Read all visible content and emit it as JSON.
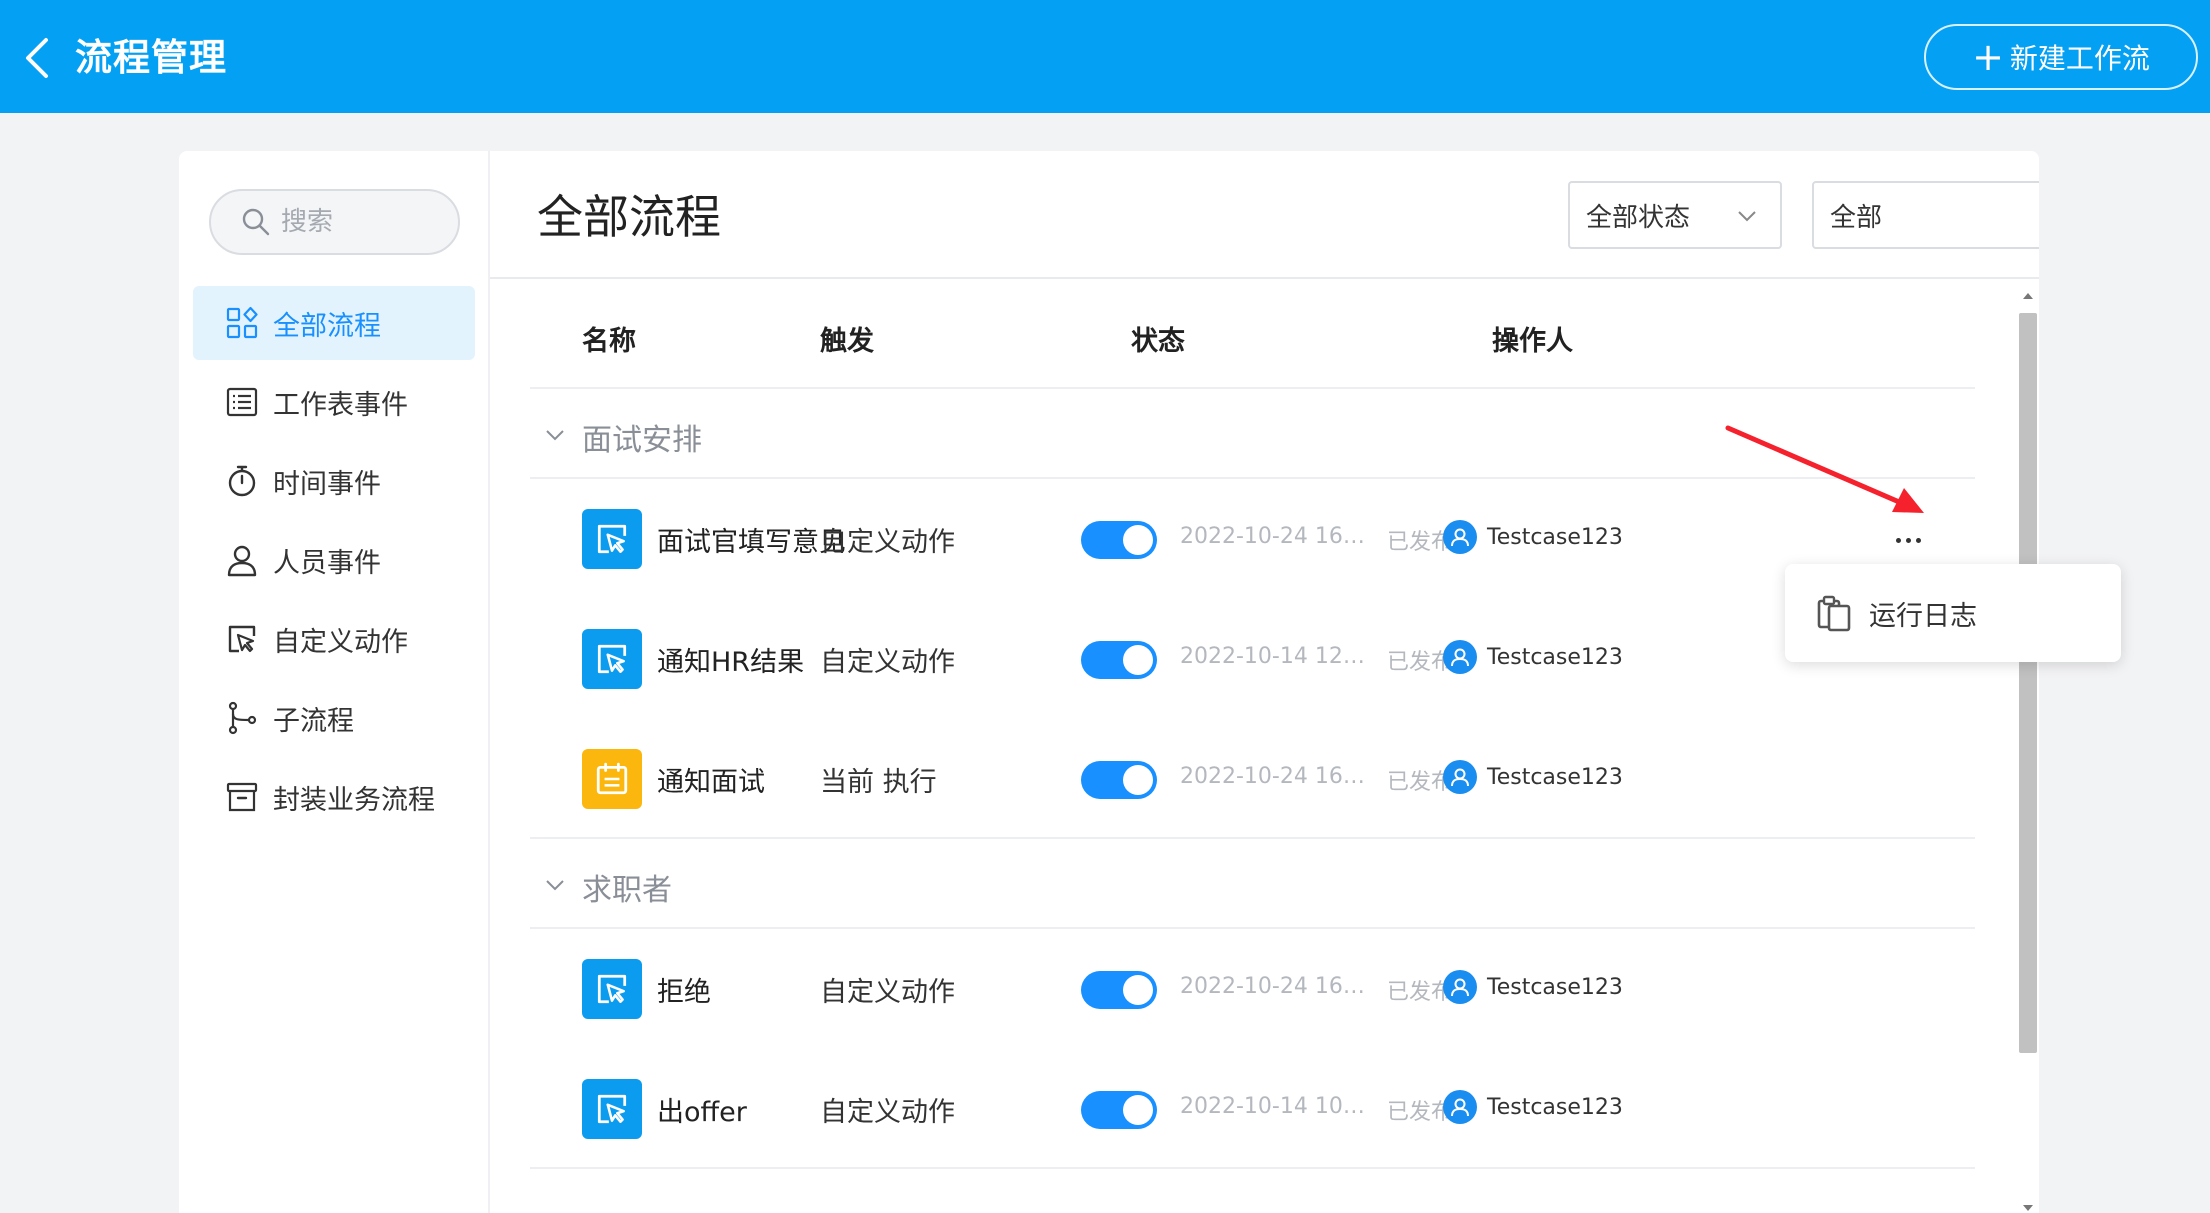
{
  "header": {
    "title": "流程管理",
    "new_button": "新建工作流"
  },
  "sidebar": {
    "search_placeholder": "搜索",
    "items": [
      {
        "label": "全部流程",
        "icon": "grid-icon",
        "active": true
      },
      {
        "label": "工作表事件",
        "icon": "list-icon"
      },
      {
        "label": "时间事件",
        "icon": "stopwatch-icon"
      },
      {
        "label": "人员事件",
        "icon": "person-icon"
      },
      {
        "label": "自定义动作",
        "icon": "cursor-click-icon"
      },
      {
        "label": "子流程",
        "icon": "branch-icon"
      },
      {
        "label": "封装业务流程",
        "icon": "archive-icon"
      }
    ]
  },
  "main": {
    "title": "全部流程",
    "status_filter": "全部状态",
    "type_filter": "全部",
    "columns": {
      "name": "名称",
      "trigger": "触发",
      "status": "状态",
      "operator": "操作人"
    },
    "groups": [
      {
        "label": "面试安排",
        "rows": [
          {
            "name": "面试官填写意见",
            "trigger": "自定义动作",
            "enabled": true,
            "date": "2022-10-24 16:2...",
            "published": "已发布",
            "user": "Testcase123",
            "icon": "cursor-click-icon",
            "icon_color": "#0b9cf0"
          },
          {
            "name": "通知HR结果",
            "trigger": "自定义动作",
            "enabled": true,
            "date": "2022-10-14 12:2...",
            "published": "已发布",
            "user": "Testcase123",
            "icon": "cursor-click-icon",
            "icon_color": "#0b9cf0"
          },
          {
            "name": "通知面试",
            "trigger": "当前 执行",
            "enabled": true,
            "date": "2022-10-24 16:0...",
            "published": "已发布",
            "user": "Testcase123",
            "icon": "calendar-icon",
            "icon_color": "#fbb70e"
          }
        ]
      },
      {
        "label": "求职者",
        "rows": [
          {
            "name": "拒绝",
            "trigger": "自定义动作",
            "enabled": true,
            "date": "2022-10-24 16:0...",
            "published": "已发布",
            "user": "Testcase123",
            "icon": "cursor-click-icon",
            "icon_color": "#0b9cf0"
          },
          {
            "name": "出offer",
            "trigger": "自定义动作",
            "enabled": true,
            "date": "2022-10-14 10:4...",
            "published": "已发布",
            "user": "Testcase123",
            "icon": "cursor-click-icon",
            "icon_color": "#0b9cf0"
          }
        ]
      }
    ]
  },
  "menu": {
    "run_log": "运行日志"
  },
  "colors": {
    "header_bg": "#03a0f4",
    "accent": "#1890ff",
    "annotation_arrow": "#f5222d"
  }
}
